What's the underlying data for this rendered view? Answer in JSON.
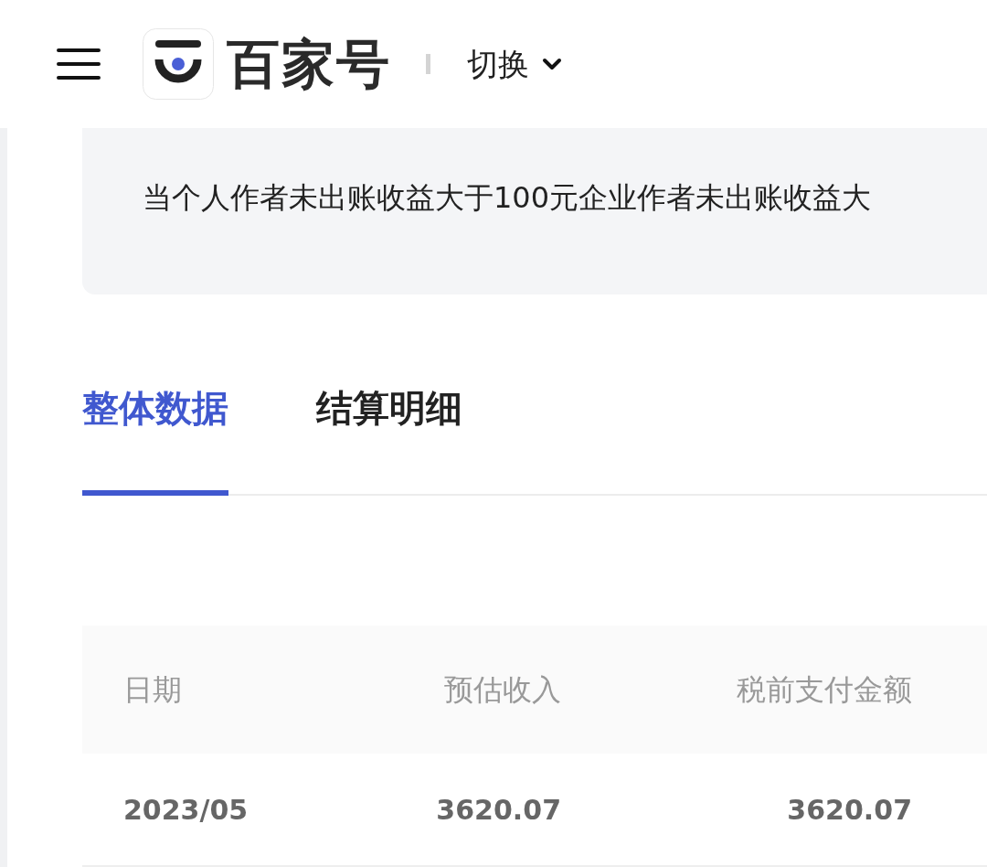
{
  "header": {
    "logo_text": "百家号",
    "switch_label": "切换"
  },
  "notice": {
    "text": "当个人作者未出账收益大于100元企业作者未出账收益大"
  },
  "tabs": [
    {
      "label": "整体数据",
      "selected": true
    },
    {
      "label": "结算明细",
      "selected": false
    }
  ],
  "table": {
    "columns": [
      "日期",
      "预估收入",
      "税前支付金额"
    ],
    "rows": [
      [
        "2023/05",
        "3620.07",
        "3620.07"
      ]
    ]
  }
}
